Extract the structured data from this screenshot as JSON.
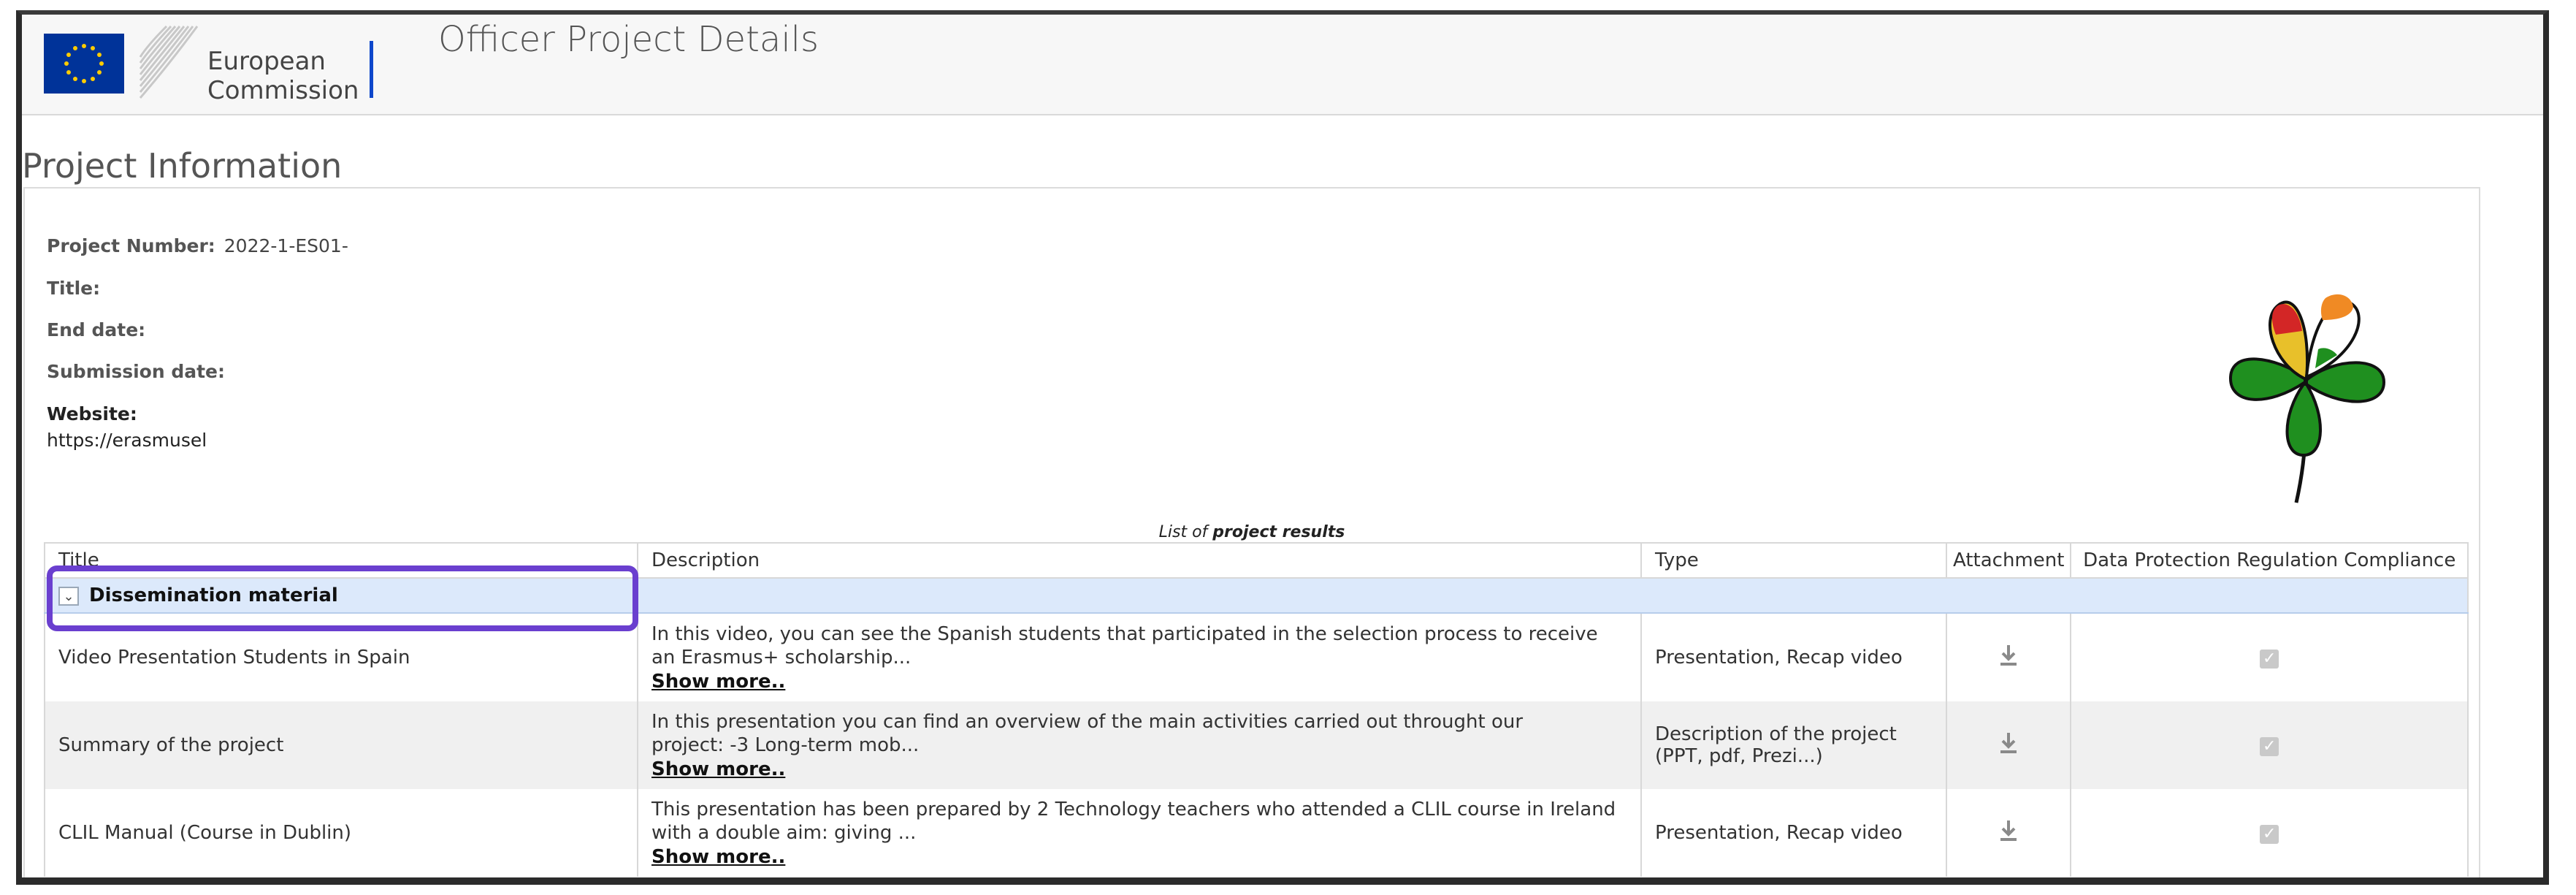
{
  "header": {
    "logo_line1": "European",
    "logo_line2": "Commission",
    "page_title": "Officer Project Details"
  },
  "section_title": "Project Information",
  "project": {
    "number_label": "Project Number:",
    "number_value": "2022-1-ES01-",
    "title_label": "Title:",
    "end_date_label": "End date:",
    "submission_label": "Submission date:",
    "website_label": "Website:",
    "website_value": "https://erasmusel"
  },
  "results": {
    "caption_prefix": "List of ",
    "caption_bold": "project results",
    "columns": [
      "Title",
      "Description",
      "Type",
      "Attachment",
      "Data Protection Regulation Compliance"
    ],
    "group_label": "Dissemination material",
    "show_more": "Show more..",
    "rows": [
      {
        "title": "Video Presentation Students in Spain",
        "description": "In this video, you can see the Spanish students that participated in the selection process to receive an Erasmus+ scholarship...",
        "type": "Presentation, Recap video"
      },
      {
        "title": "Summary of the project",
        "description": "In this presentation you can find an overview of the main activities carried out throught our           project: -3 Long-term mob...",
        "type": "Description of the project (PPT, pdf, Prezi...)"
      },
      {
        "title": "CLIL Manual (Course in Dublin)",
        "description": "This presentation has been prepared by 2 Technology teachers who attended a CLIL course in Ireland with a double aim: giving ...",
        "type": "Presentation, Recap video"
      }
    ]
  },
  "colors": {
    "ec_blue": "#003399",
    "group_row_bg": "#dce9fb",
    "highlight": "#6a3fcf"
  }
}
